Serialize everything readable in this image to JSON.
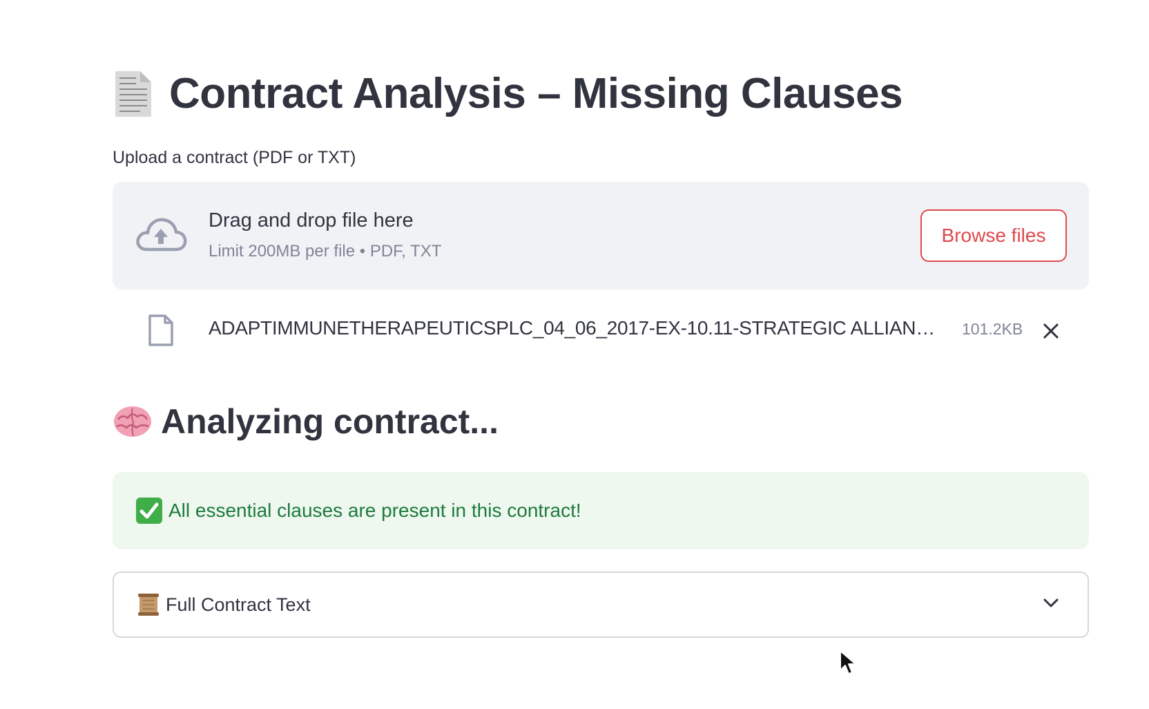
{
  "title": {
    "icon": "page-document-icon",
    "text": "Contract Analysis – Missing Clauses"
  },
  "uploader": {
    "label": "Upload a contract (PDF or TXT)",
    "dropzone_title": "Drag and drop file here",
    "dropzone_limit": "Limit 200MB per file • PDF, TXT",
    "browse_label": "Browse files",
    "accent_color": "#e0484c"
  },
  "uploaded_file": {
    "name": "ADAPTIMMUNETHERAPEUTICSPLC_04_06_2017-EX-10.11-STRATEGIC ALLIANCE...",
    "size": "101.2KB"
  },
  "analysis": {
    "icon": "brain-icon",
    "heading": "Analyzing contract...",
    "success_message": "All essential clauses are present in this contract!",
    "success_icon": "check-mark-icon"
  },
  "expander": {
    "icon": "scroll-icon",
    "label": "Full Contract Text",
    "expanded": false
  }
}
